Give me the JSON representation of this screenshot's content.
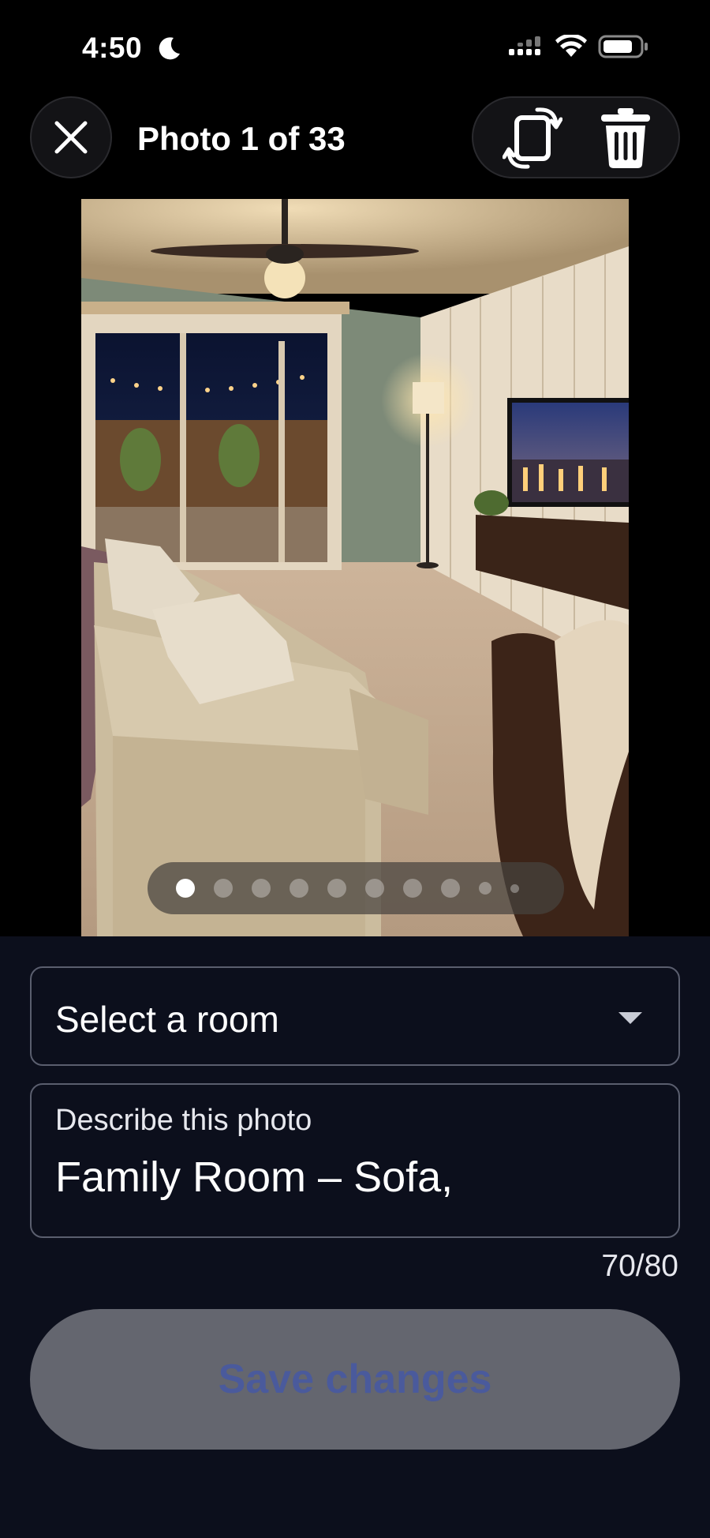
{
  "status": {
    "time": "4:50"
  },
  "header": {
    "title": "Photo 1 of 33"
  },
  "photo": {
    "description": "Living room photo with sofa, floor lamp, TV stand and sliding glass doors to lit patio"
  },
  "pager": {
    "dot_count": 10,
    "active_index": 0
  },
  "form": {
    "room_select": {
      "value": "Select a room"
    },
    "description": {
      "label": "Describe this photo",
      "value": "Family Room – Sofa,",
      "counter": "70/80"
    },
    "save_label": "Save changes"
  },
  "colors": {
    "panel_bg": "#0c0f1c",
    "save_bg": "#64666f",
    "save_text": "#4a5a9c",
    "border": "#5a5e6e"
  },
  "icons": [
    "moon-icon",
    "signal-icon",
    "wifi-icon",
    "battery-icon",
    "close-icon",
    "rotate-icon",
    "trash-icon",
    "chevron-down-icon"
  ]
}
